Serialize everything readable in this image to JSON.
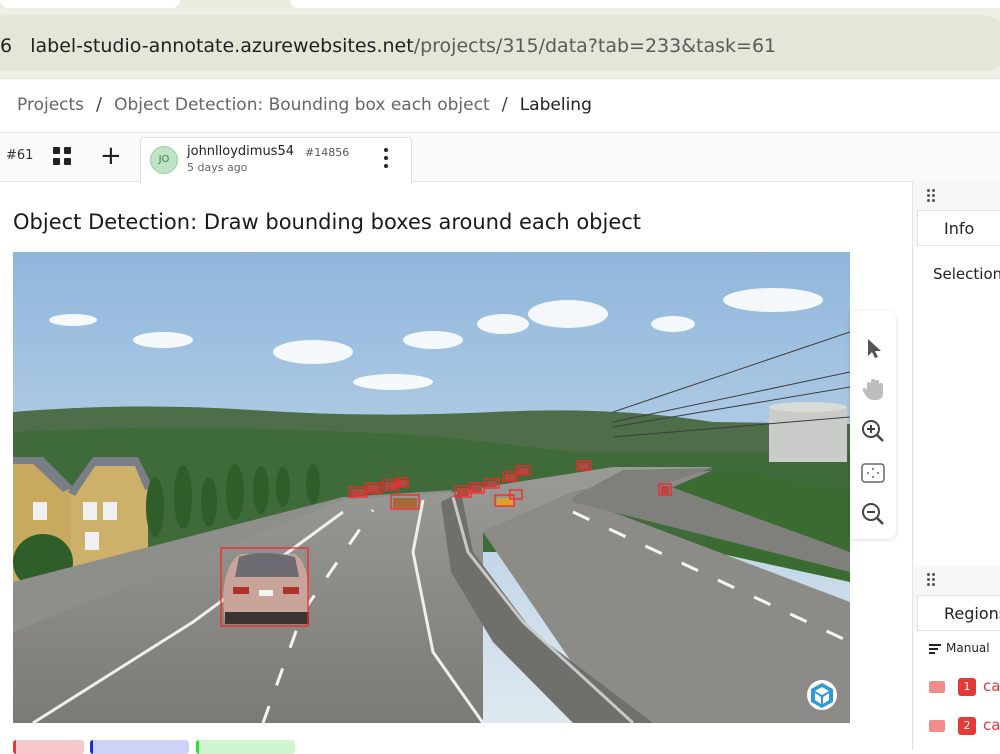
{
  "browser": {
    "url_lead": "6",
    "url_host": "label-studio-annotate.azurewebsites.net",
    "url_path": "/projects/315/data?tab=233&task=61"
  },
  "breadcrumb": {
    "items": [
      "Projects",
      "Object Detection: Bounding box each object",
      "Labeling"
    ],
    "separator": "/"
  },
  "taskbar": {
    "task_id": "#61",
    "annotation": {
      "avatar_initials": "JO",
      "user": "johnlloydimus54",
      "annotation_id": "#14856",
      "time": "5 days ago"
    }
  },
  "main": {
    "title": "Object Detection: Draw bounding boxes around each object"
  },
  "tools": [
    "pointer-icon",
    "hand-icon",
    "zoom-in-icon",
    "fit-to-screen-icon",
    "zoom-out-icon"
  ],
  "right_panel": {
    "info_tab": "Info",
    "selection_label": "Selection",
    "regions_tab": "Regions",
    "order_label": "Manual",
    "regions": [
      {
        "index": "1",
        "label": "ca"
      },
      {
        "index": "2",
        "label": "ca"
      }
    ]
  },
  "colors": {
    "bbox": "#e53935",
    "accent_green": "#3d7a48",
    "label_red": "#e53935",
    "label_blue": "#1f2cd6",
    "label_green": "#2ee02e"
  }
}
